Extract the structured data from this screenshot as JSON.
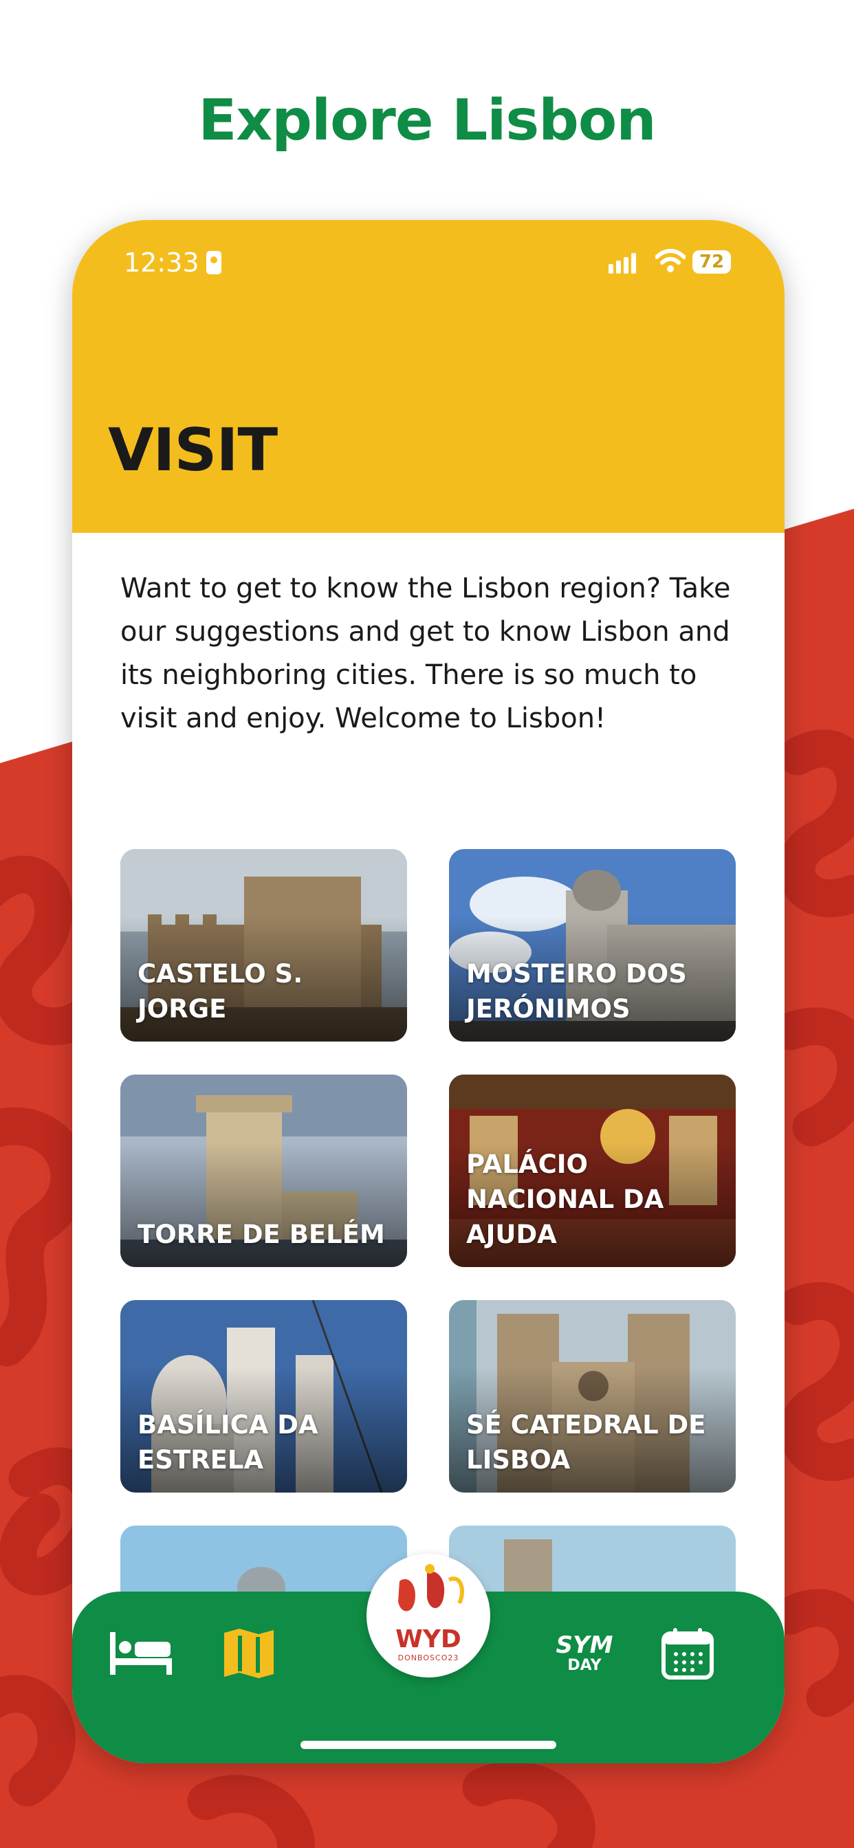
{
  "headline": "Explore Lisbon",
  "status": {
    "time": "12:33",
    "battery": "72"
  },
  "screen": {
    "title": "VISIT",
    "intro": "Want to get to know the Lisbon region? Take our suggestions and get to know Lisbon and its neighboring cities. There is so much to visit and enjoy. Welcome to Lisbon!"
  },
  "places": [
    {
      "label": "CASTELO S. JORGE"
    },
    {
      "label": "MOSTEIRO DOS JERÓNIMOS"
    },
    {
      "label": "TORRE DE BELÉM"
    },
    {
      "label": "PALÁCIO NACIONAL DA AJUDA"
    },
    {
      "label": "BASÍLICA DA ESTRELA"
    },
    {
      "label": "SÉ CATEDRAL DE LISBOA"
    }
  ],
  "tabbar": {
    "logo_text": "WYD",
    "logo_sub": "DONBOSCO23",
    "sym_line1": "SYM",
    "sym_line2": "DAY"
  },
  "colors": {
    "brand_green": "#0f8c45",
    "brand_yellow": "#f4bd1e",
    "brand_red": "#d63b2a",
    "active_tab": "#f4bd1e"
  },
  "icons": [
    "bed-icon",
    "map-icon",
    "wyd-logo",
    "sym-day-icon",
    "calendar-icon",
    "signal-icon",
    "wifi-icon",
    "battery-icon"
  ]
}
